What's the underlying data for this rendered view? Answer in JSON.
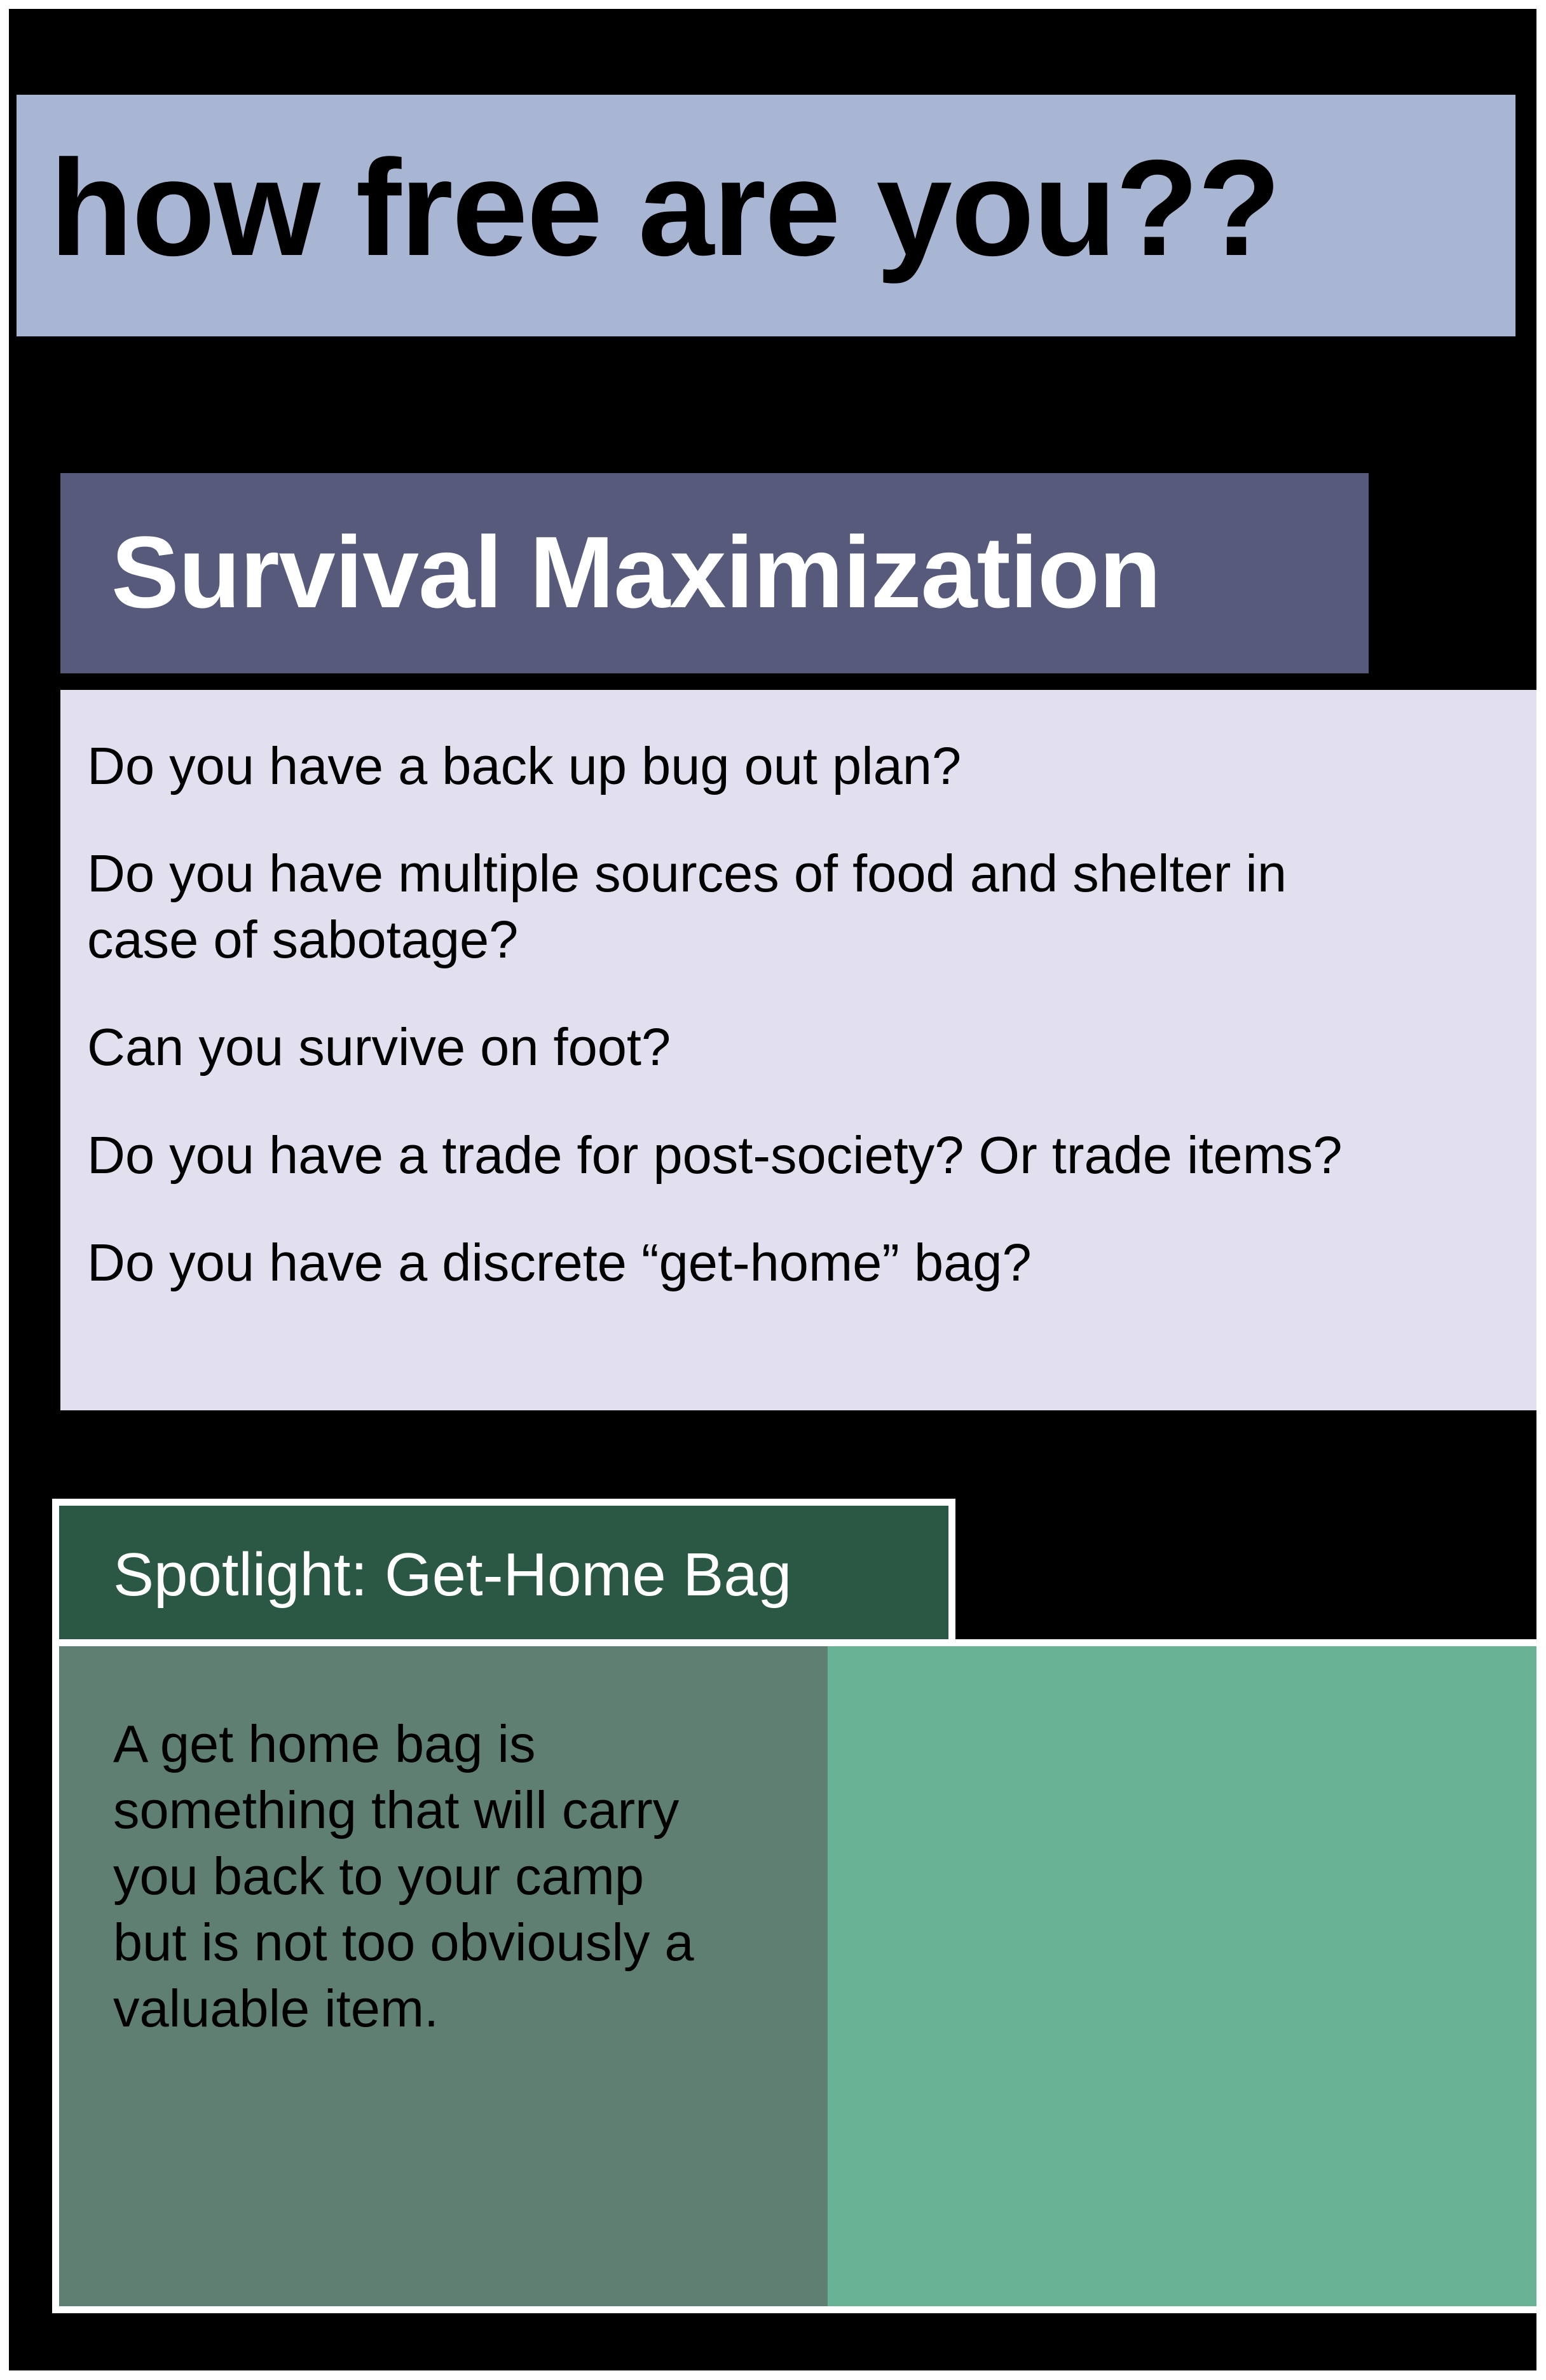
{
  "title": "how free are you??",
  "section": {
    "heading": "Survival Maximization",
    "questions": [
      "Do you have a back up bug out plan?",
      "Do you have multiple sources of food and shelter in",
      "case of sabotage?",
      "Can you survive on foot?",
      "Do you have a trade for post-society? Or trade items?",
      "Do you have a discrete “get-home” bag?"
    ]
  },
  "spotlight": {
    "heading": "Spotlight: Get-Home Bag",
    "lines": [
      "A get home bag is",
      "something that will carry",
      "you back to your camp",
      "but is not too obviously a",
      "valuable item."
    ]
  },
  "colors": {
    "background": "#000000",
    "title_box": "#a9b6d3",
    "section_header": "#575a7b",
    "question_panel": "#e2e0ee",
    "spotlight_tab": "#2a5844",
    "spotlight_text_panel": "#5f7f72",
    "spotlight_image_panel": "#6ab295"
  }
}
